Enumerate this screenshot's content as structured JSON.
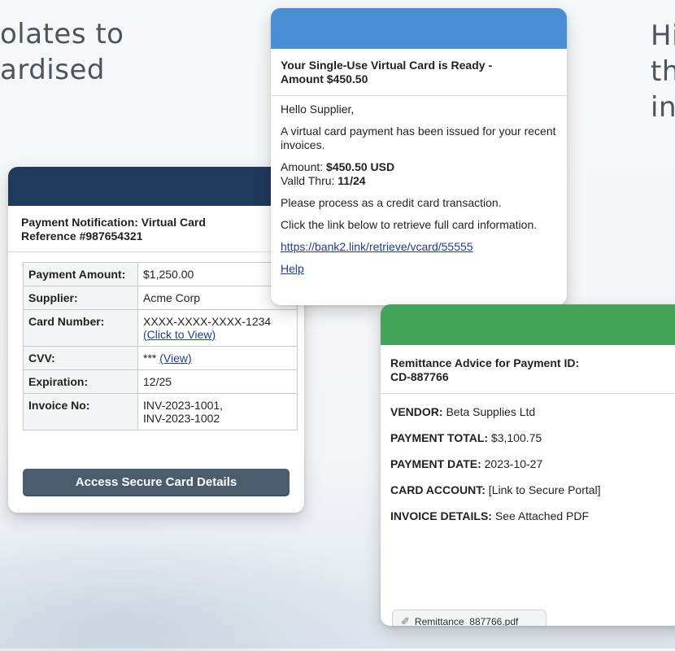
{
  "background": {
    "left_lines": [
      "olates to",
      "ardised"
    ],
    "right_lines": [
      "Hi",
      "th",
      "in"
    ]
  },
  "card1": {
    "header_color": "#1f3a5c",
    "title_line1": "Payment Notification: Virtual Card",
    "title_line2": "Reference #987654321",
    "rows": [
      {
        "label": "Payment Amount:",
        "value": "$1,250.00"
      },
      {
        "label": "Supplier:",
        "value": "Acme Corp"
      },
      {
        "label": "Card Number:",
        "value": "XXXX-XXXX-XXXX-1234",
        "link": "(Click to View)"
      },
      {
        "label": "CVV:",
        "value": "***",
        "link": "(View)"
      },
      {
        "label": "Expiration:",
        "value": "12/25"
      },
      {
        "label": "Invoice No:",
        "value": "INV-2023-1001,",
        "value2": "INV-2023-1002"
      }
    ],
    "button_label": "Access Secure Card Details"
  },
  "card2": {
    "header_color": "#4a8fd6",
    "title_line1": "Your Single-Use Virtual Card is Ready -",
    "title_line2": "Amount $450.50",
    "greeting": "Hello Supplier,",
    "intro": "A virtual card payment has been issued for your recent invoices.",
    "amount_label": "Amount: ",
    "amount_value": "$450.50 USD",
    "valid_label": "Valld Thru: ",
    "valid_value": "11/24",
    "instruction": "Please process as a credit card transaction.",
    "link_prompt": "Click the link below to retrieve full card information.",
    "link_url": "https://bank2.link/retrieve/vcard/55555",
    "help_label": "Help"
  },
  "card3": {
    "header_color": "#46a35a",
    "title_line1": "Remittance Advice for Payment ID:",
    "title_line2": "CD-887766",
    "rows": [
      {
        "label": "VENDOR:",
        "value": " Beta Supplies Ltd"
      },
      {
        "label": "PAYMENT TOTAL:",
        "value": " $3,100.75"
      },
      {
        "label": "PAYMENT DATE:",
        "value": " 2023-10-27"
      },
      {
        "label": "CARD ACCOUNT:",
        "value": " [Link to Secure Portal]"
      },
      {
        "label": "INVOICE DETAILS:",
        "value": " See Attached PDF"
      }
    ],
    "attachment": "Remittance_887766.pdf"
  }
}
